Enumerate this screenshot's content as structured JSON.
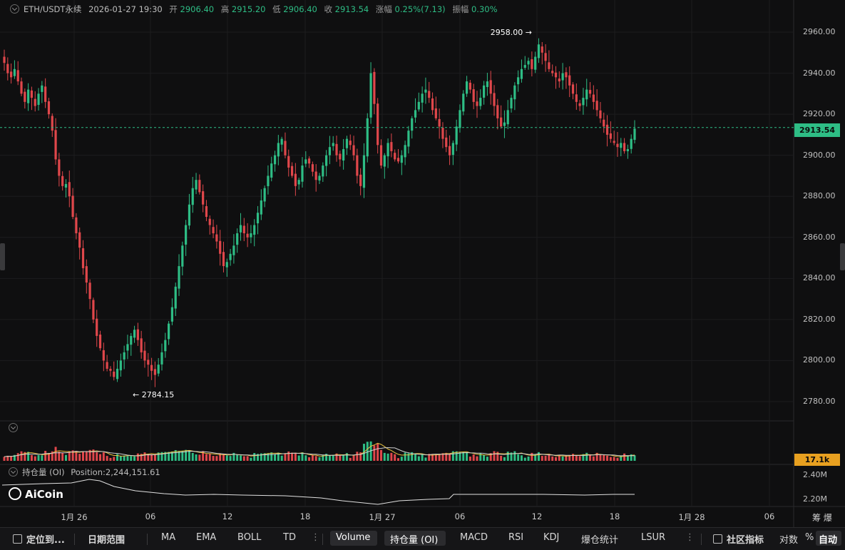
{
  "ohlc_bar": {
    "symbol": "ETH/USDT永续",
    "datetime": "2026-01-27 19:30",
    "open_label": "开",
    "open": "2906.40",
    "high_label": "高",
    "high": "2915.20",
    "low_label": "低",
    "low": "2906.40",
    "close_label": "收",
    "close": "2913.54",
    "change_label": "涨幅",
    "change": "0.25%(7.13)",
    "amplitude_label": "振幅",
    "amplitude": "0.30%"
  },
  "price_axis": {
    "ticks": [
      "2960.00",
      "2940.00",
      "2920.00",
      "2900.00",
      "2880.00",
      "2860.00",
      "2840.00",
      "2820.00",
      "2800.00",
      "2780.00"
    ],
    "current_price_tag": "2913.54"
  },
  "annotations": {
    "high_marker": "2958.00",
    "low_marker": "2784.15"
  },
  "volume_panel": {
    "last_value_tag": "17.1k"
  },
  "oi_panel": {
    "title": "持仓量 (OI)",
    "position_text": "Position:2,244,151.61",
    "ticks": [
      "2.40M",
      "2.20M"
    ]
  },
  "time_axis": {
    "labels": [
      "1月 26",
      "06",
      "12",
      "18",
      "1月 27",
      "06",
      "12",
      "18",
      "1月 28",
      "06"
    ],
    "corner": "筹 爆"
  },
  "logo": "AiCoin",
  "toolbar": {
    "locate": "定位到...",
    "date_range": "日期范围",
    "ma": "MA",
    "ema": "EMA",
    "boll": "BOLL",
    "td": "TD",
    "volume": "Volume",
    "oi": "持仓量 (OI)",
    "macd": "MACD",
    "rsi": "RSI",
    "kdj": "KDJ",
    "liquidation": "爆仓统计",
    "lsur": "LSUR",
    "community": "社区指标",
    "log": "对数",
    "percent": "%",
    "auto": "自动"
  },
  "colors": {
    "up": "#2ebd85",
    "down": "#e0474b",
    "background": "#0f0f10",
    "volume_tag": "#e8a020"
  },
  "chart_data": {
    "type": "candlestick",
    "interval": "30m",
    "y_range": [
      2772,
      2968
    ],
    "close_series": [
      2945,
      2940,
      2938,
      2942,
      2936,
      2930,
      2926,
      2932,
      2928,
      2924,
      2930,
      2934,
      2926,
      2920,
      2912,
      2898,
      2890,
      2885,
      2886,
      2880,
      2870,
      2862,
      2855,
      2845,
      2838,
      2830,
      2820,
      2812,
      2806,
      2800,
      2796,
      2795,
      2792,
      2796,
      2800,
      2804,
      2808,
      2812,
      2815,
      2810,
      2804,
      2800,
      2798,
      2795,
      2793,
      2798,
      2804,
      2810,
      2818,
      2826,
      2836,
      2846,
      2856,
      2866,
      2876,
      2884,
      2888,
      2882,
      2876,
      2870,
      2866,
      2862,
      2858,
      2852,
      2846,
      2848,
      2852,
      2856,
      2862,
      2866,
      2862,
      2860,
      2862,
      2866,
      2872,
      2878,
      2884,
      2890,
      2896,
      2900,
      2906,
      2908,
      2900,
      2894,
      2890,
      2885,
      2888,
      2895,
      2898,
      2896,
      2892,
      2888,
      2890,
      2895,
      2900,
      2904,
      2906,
      2900,
      2898,
      2903,
      2908,
      2905,
      2900,
      2890,
      2885,
      2900,
      2918,
      2940,
      2925,
      2905,
      2895,
      2900,
      2906,
      2902,
      2898,
      2897,
      2900,
      2905,
      2912,
      2918,
      2922,
      2926,
      2930,
      2932,
      2928,
      2922,
      2918,
      2914,
      2908,
      2904,
      2900,
      2906,
      2914,
      2922,
      2930,
      2936,
      2932,
      2926,
      2924,
      2928,
      2934,
      2936,
      2930,
      2924,
      2918,
      2914,
      2916,
      2922,
      2928,
      2934,
      2938,
      2942,
      2944,
      2946,
      2942,
      2948,
      2954,
      2950,
      2946,
      2942,
      2940,
      2938,
      2936,
      2940,
      2938,
      2934,
      2930,
      2926,
      2924,
      2928,
      2932,
      2930,
      2926,
      2922,
      2918,
      2914,
      2910,
      2908,
      2906,
      2904,
      2906,
      2902,
      2903,
      2908,
      2913
    ]
  }
}
